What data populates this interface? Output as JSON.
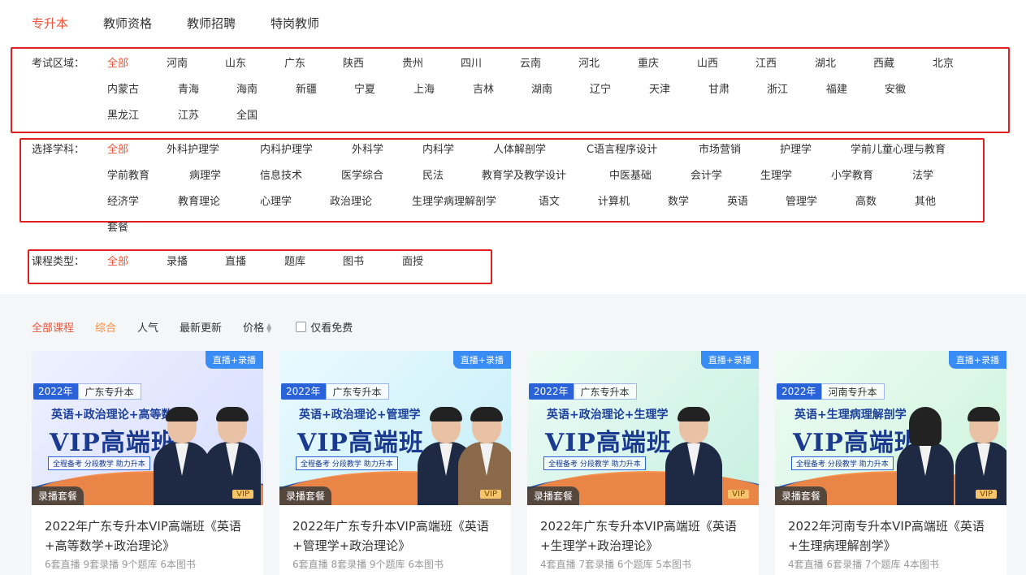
{
  "top_tabs": [
    "专升本",
    "教师资格",
    "教师招聘",
    "特岗教师"
  ],
  "region": {
    "label": "考试区域：",
    "items": [
      "全部",
      "河南",
      "山东",
      "广东",
      "陕西",
      "贵州",
      "四川",
      "云南",
      "河北",
      "重庆",
      "山西",
      "江西",
      "湖北",
      "西藏",
      "北京",
      "内蒙古",
      "青海",
      "海南",
      "新疆",
      "宁夏",
      "上海",
      "吉林",
      "湖南",
      "辽宁",
      "天津",
      "甘肃",
      "浙江",
      "福建",
      "安徽",
      "黑龙江",
      "江苏",
      "全国"
    ]
  },
  "subject": {
    "label": "选择学科：",
    "items": [
      "全部",
      "外科护理学",
      "内科护理学",
      "外科学",
      "内科学",
      "人体解剖学",
      "C语言程序设计",
      "市场营销",
      "护理学",
      "学前儿童心理与教育",
      "学前教育",
      "病理学",
      "信息技术",
      "医学综合",
      "民法",
      "教育学及教学设计",
      "中医基础",
      "会计学",
      "生理学",
      "小学教育",
      "法学",
      "经济学",
      "教育理论",
      "心理学",
      "政治理论",
      "生理学病理解剖学",
      "语文",
      "计算机",
      "数学",
      "英语",
      "管理学",
      "高数",
      "其他",
      "套餐"
    ]
  },
  "course_type": {
    "label": "课程类型：",
    "items": [
      "全部",
      "录播",
      "直播",
      "题库",
      "图书",
      "面授"
    ]
  },
  "sort_bar": {
    "all_courses": "全部课程",
    "comprehensive": "综合",
    "popular": "人气",
    "latest": "最新更新",
    "price": "价格",
    "free_only": "仅看免费"
  },
  "cards": [
    {
      "badge": "直播+录播",
      "year": "2022年",
      "region": "广东专升本",
      "subjects": "英语+政治理论+高等数学",
      "vip_title": "VIP高端班",
      "slogan": "全程备考 分段教学 助力升本",
      "vip": "VIP",
      "package_tag": "录播套餐",
      "title": "2022年广东专升本VIP高端班《英语+高等数学+政治理论》",
      "meta": "6套直播 9套录播 9个题库 6本图书",
      "bg": "#d6dcff",
      "bg2": "#eef1ff"
    },
    {
      "badge": "直播+录播",
      "year": "2022年",
      "region": "广东专升本",
      "subjects": "英语+政治理论+管理学",
      "vip_title": "VIP高端班",
      "slogan": "全程备考 分段教学 助力升本",
      "vip": "VIP",
      "package_tag": "录播套餐",
      "title": "2022年广东专升本VIP高端班《英语+管理学+政治理论》",
      "meta": "6套直播 8套录播 9个题库 6本图书",
      "bg": "#c6eef7",
      "bg2": "#eafaff"
    },
    {
      "badge": "直播+录播",
      "year": "2022年",
      "region": "广东专升本",
      "subjects": "英语+政治理论+生理学",
      "vip_title": "VIP高端班",
      "slogan": "全程备考 分段教学 助力升本",
      "vip": "VIP",
      "package_tag": "录播套餐",
      "title": "2022年广东专升本VIP高端班《英语+生理学+政治理论》",
      "meta": "4套直播 7套录播 6个题库 5本图书",
      "bg": "#c7f0e2",
      "bg2": "#ecfbf5"
    },
    {
      "badge": "直播+录播",
      "year": "2022年",
      "region": "河南专升本",
      "subjects": "英语+生理病理解剖学",
      "vip_title": "VIP高端班",
      "slogan": "全程备考 分段教学 助力升本",
      "vip": "VIP",
      "package_tag": "录播套餐",
      "title": "2022年河南专升本VIP高端班《英语+生理病理解剖学》",
      "meta": "4套直播 6套录播 7个题库 4本图书",
      "bg": "#cdf3dc",
      "bg2": "#eefcf3"
    }
  ],
  "colors": {
    "accent": "#f0563c",
    "highlight_box": "#e02020",
    "banner_blue": "#1a3a8f"
  }
}
